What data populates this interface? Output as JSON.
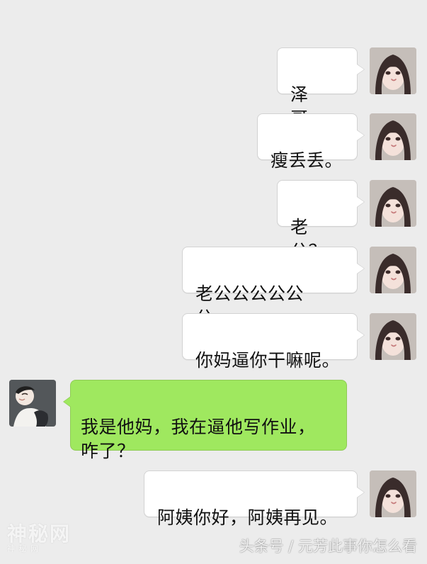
{
  "messages": [
    {
      "side": "right",
      "text": "泽哥。"
    },
    {
      "side": "right",
      "text": "瘦丢丢。"
    },
    {
      "side": "right",
      "text": "老公？"
    },
    {
      "side": "right",
      "text": "老公公公公公公。。"
    },
    {
      "side": "right",
      "text": "你妈逼你干嘛呢。"
    },
    {
      "side": "left",
      "text": "我是他妈，我在逼他写作业，\n咋了？"
    },
    {
      "side": "right",
      "text": "阿姨你好，阿姨再见。"
    }
  ],
  "watermark": {
    "left_title": "神秘网",
    "left_subtitle": "神 秘 网",
    "right_text": "头条号 / 元芳此事你怎么看"
  },
  "colors": {
    "background": "#ececec",
    "right_bubble": "#ffffff",
    "left_bubble": "#9fe85f"
  }
}
